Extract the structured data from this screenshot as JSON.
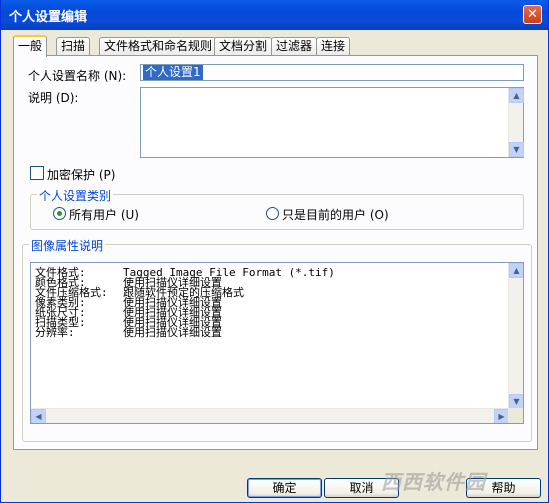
{
  "window": {
    "title": "个人设置编辑"
  },
  "tabs": [
    {
      "label": "一般",
      "active": true
    },
    {
      "label": "扫描"
    },
    {
      "label": "文件格式和命名规则"
    },
    {
      "label": "文档分割"
    },
    {
      "label": "过滤器"
    },
    {
      "label": "连接"
    }
  ],
  "general": {
    "name_label": "个人设置名称 (N):",
    "name_value": "个人设置1",
    "desc_label": "说明 (D):",
    "desc_value": "",
    "encrypt_label": "加密保护 (P)",
    "encrypt_checked": false
  },
  "category": {
    "title": "个人设置类别",
    "all_users_label": "所有用户 (U)",
    "current_user_label": "只是目前的用户 (O)",
    "selected": "all_users"
  },
  "image_props": {
    "title": "图像属性说明",
    "rows": [
      {
        "key": "文件格式:",
        "value": "Tagged Image File Format (*.tif)"
      },
      {
        "key": "颜色格式:",
        "value": "使用扫描仪详细设置"
      },
      {
        "key": "文件压缩格式:",
        "value": "跟随软件预定的压缩格式"
      },
      {
        "key": "像素类别:",
        "value": "使用扫描仪详细设置"
      },
      {
        "key": "纸张尺寸:",
        "value": "使用扫描仪详细设置"
      },
      {
        "key": "扫描类型:",
        "value": "使用扫描仪详细设置"
      },
      {
        "key": "分辨率:",
        "value": "使用扫描仪详细设置"
      }
    ]
  },
  "buttons": {
    "ok": "确定",
    "cancel": "取消",
    "help": "帮助"
  },
  "watermark": "西西软件园",
  "icons": {
    "close": "close-icon",
    "up": "arrow-up-icon",
    "down": "arrow-down-icon",
    "left": "arrow-left-icon",
    "right": "arrow-right-icon"
  },
  "colors": {
    "titlebar": "#0a5ce8",
    "group_title": "#0046d5",
    "selection": "#316ac5",
    "dialog_bg": "#ece9d8"
  }
}
